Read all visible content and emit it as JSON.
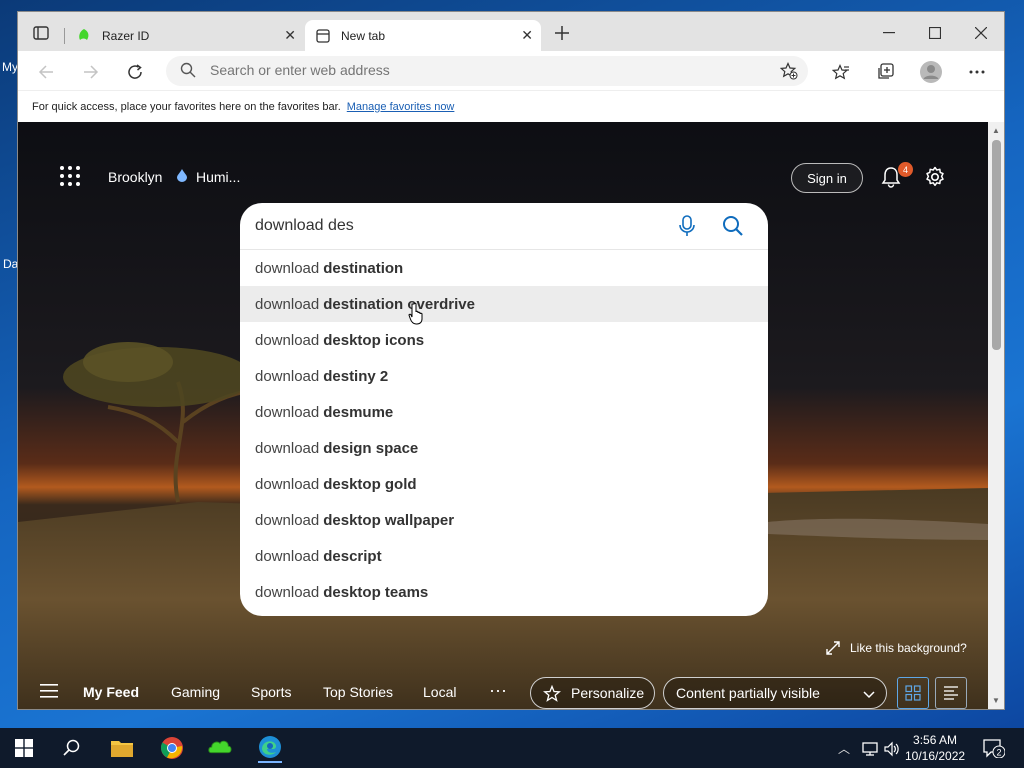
{
  "desktop": {
    "fragments": [
      "My",
      "Da"
    ]
  },
  "tabs": [
    {
      "title": "Razer ID",
      "icon": "razer-icon"
    },
    {
      "title": "New tab",
      "icon": "newtab-icon"
    }
  ],
  "toolbar": {
    "address_placeholder": "Search or enter web address"
  },
  "favbar": {
    "text": "For quick access, place your favorites here on the favorites bar.",
    "link": "Manage favorites now"
  },
  "ntp": {
    "weather_city": "Brooklyn",
    "weather_humidity": "Humi...",
    "sign_in": "Sign in",
    "notification_count": "4",
    "like_background": "Like this background?"
  },
  "search": {
    "query": "download des",
    "suggestion_prefix": "download",
    "suggestions": [
      "destination",
      "destination overdrive",
      "desktop icons",
      "destiny 2",
      "desmume",
      "design space",
      "desktop gold",
      "desktop wallpaper",
      "descript",
      "desktop teams"
    ],
    "hovered_index": 1
  },
  "feed": {
    "tabs": [
      "My Feed",
      "Gaming",
      "Sports",
      "Top Stories",
      "Local"
    ],
    "more": "···",
    "personalize": "Personalize",
    "visibility": "Content partially visible"
  },
  "taskbar": {
    "time": "3:56 AM",
    "date": "10/16/2022",
    "notification_count": "2"
  },
  "colors": {
    "accent": "#0067c0",
    "badge": "#e05a2a",
    "link": "#1a5fb4"
  }
}
